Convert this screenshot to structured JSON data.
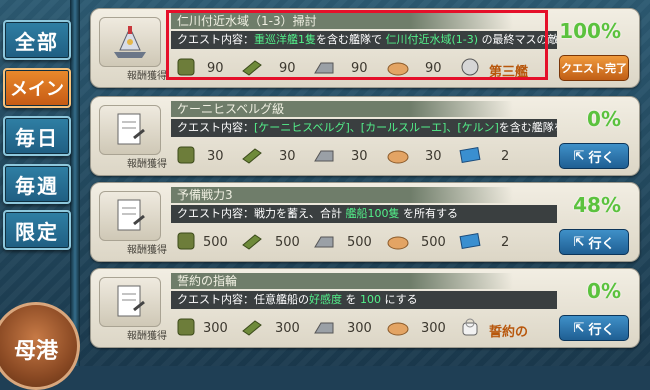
{
  "sidebar": {
    "items": [
      {
        "label": "全部"
      },
      {
        "label": "メイン"
      },
      {
        "label": "毎日"
      },
      {
        "label": "毎週"
      },
      {
        "label": "限定"
      }
    ],
    "port_label": "母港"
  },
  "quests": [
    {
      "title": "仁川付近水域（1-3）掃討",
      "desc_prefix": "クエスト内容：",
      "desc_parts": [
        "重巡洋艦1隻",
        "を含む艦隊で",
        "仁川付近水域(1-3)",
        "の最終マスの敵艦"
      ],
      "reward_label": "報酬獲得",
      "rewards": {
        "fuel": "90",
        "ammo": "90",
        "steel": "90",
        "bauxite": "90",
        "extra": "第三艦"
      },
      "percent": "100%",
      "action": "クエスト完了"
    },
    {
      "title": "ケーニヒスベルグ級",
      "desc_prefix": "クエスト内容：",
      "desc_parts": [
        "[ケーニヒスベルグ]、[カールスルーエ]、[ケルン]",
        "を含む艦隊を"
      ],
      "reward_label": "報酬獲得",
      "rewards": {
        "fuel": "30",
        "ammo": "30",
        "steel": "30",
        "bauxite": "30",
        "extra": "2"
      },
      "percent": "0%",
      "action": "行く"
    },
    {
      "title": "予備戦力3",
      "desc_prefix": "クエスト内容：",
      "desc_parts": [
        "戦力を蓄え、合計",
        "艦船100隻",
        "を所有する"
      ],
      "reward_label": "報酬獲得",
      "rewards": {
        "fuel": "500",
        "ammo": "500",
        "steel": "500",
        "bauxite": "500",
        "extra": "2"
      },
      "percent": "48%",
      "action": "行く"
    },
    {
      "title": "誓約の指輪",
      "desc_prefix": "クエスト内容：",
      "desc_parts": [
        "任意艦船の",
        "好感度",
        "を",
        "100",
        "にする"
      ],
      "reward_label": "報酬獲得",
      "rewards": {
        "fuel": "300",
        "ammo": "300",
        "steel": "300",
        "bauxite": "300",
        "extra": "誓約の"
      },
      "percent": "0%",
      "action": "行く"
    }
  ]
}
